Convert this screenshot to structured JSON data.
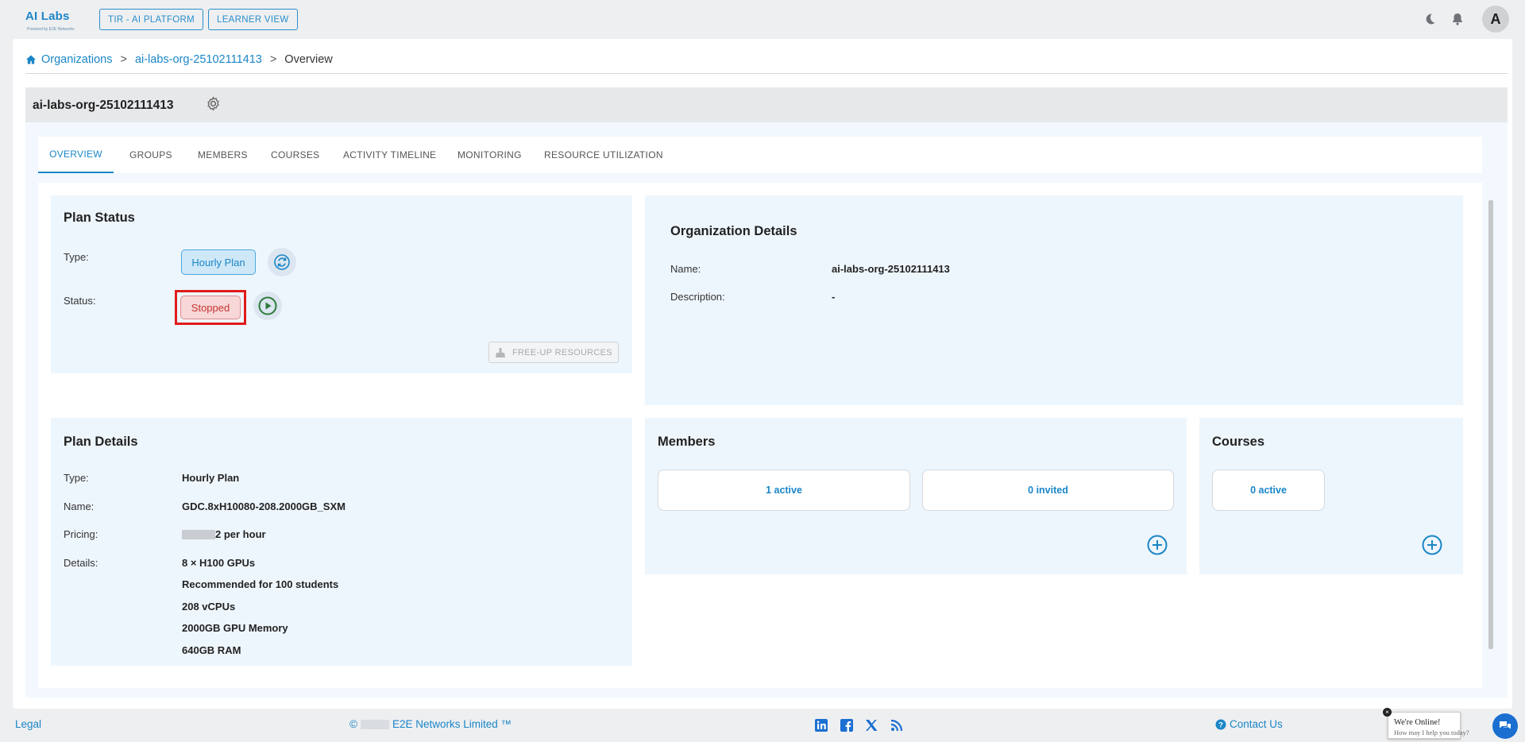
{
  "app": {
    "logo_text": "AI Labs",
    "logo_subtext": "Powered by E2E Networks",
    "platform_button": "TIR - AI PLATFORM",
    "learner_button": "LEARNER VIEW",
    "avatar_initial": "A",
    "icons": [
      "moon-icon",
      "bell-icon"
    ]
  },
  "breadcrumb": {
    "home_label": "Organizations",
    "org_label": "ai-labs-org-25102111413",
    "current": "Overview",
    "separator": ">"
  },
  "org_header": {
    "title": "ai-labs-org-25102111413"
  },
  "tabs": [
    {
      "label": "OVERVIEW",
      "active": true
    },
    {
      "label": "GROUPS",
      "active": false
    },
    {
      "label": "MEMBERS",
      "active": false
    },
    {
      "label": "COURSES",
      "active": false
    },
    {
      "label": "ACTIVITY TIMELINE",
      "active": false
    },
    {
      "label": "MONITORING",
      "active": false
    },
    {
      "label": "RESOURCE UTILIZATION",
      "active": false
    }
  ],
  "plan_status": {
    "title": "Plan Status",
    "type_label": "Type:",
    "type_value": "Hourly Plan",
    "status_label": "Status:",
    "status_value": "Stopped",
    "free_up_button": "FREE-UP RESOURCES"
  },
  "org_details": {
    "title": "Organization Details",
    "name_label": "Name:",
    "name_value": "ai-labs-org-25102111413",
    "description_label": "Description:",
    "description_value": "-"
  },
  "plan_details": {
    "title": "Plan Details",
    "type_label": "Type:",
    "type_value": "Hourly Plan",
    "name_label": "Name:",
    "name_value": "GDC.8xH10080-208.2000GB_SXM",
    "pricing_label": "Pricing:",
    "pricing_value": "2 per hour",
    "details_label": "Details:",
    "details": [
      "8 × H100 GPUs",
      "Recommended for 100 students",
      "208 vCPUs",
      "2000GB GPU Memory",
      "640GB RAM"
    ]
  },
  "members": {
    "title": "Members",
    "active": "1 active",
    "invited": "0 invited"
  },
  "courses": {
    "title": "Courses",
    "active": "0 active"
  },
  "footer": {
    "legal": "Legal",
    "copyright_symbol": "©",
    "company": "E2E Networks Limited ™",
    "contact": "Contact Us",
    "social_icons": [
      "linkedin-icon",
      "facebook-icon",
      "x-icon",
      "rss-icon"
    ]
  },
  "chat": {
    "line1": "We're Online!",
    "line2": "How may I help you today?"
  },
  "colors": {
    "accent": "#1a86c7",
    "stopped_border": "#e01b1b",
    "panel_bg": "#eef6fd"
  }
}
